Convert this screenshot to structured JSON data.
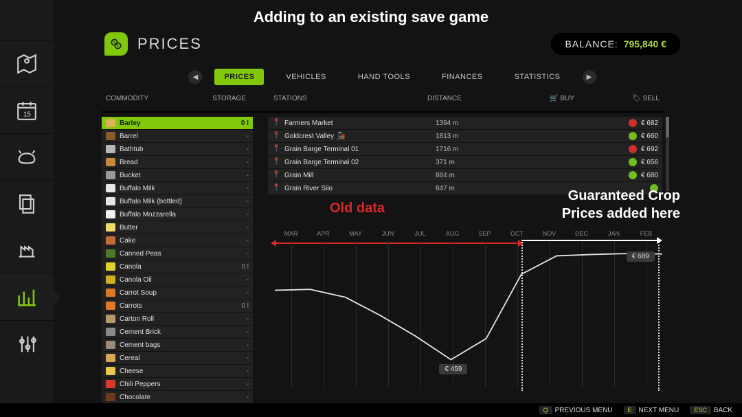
{
  "overlay_title": "Adding to an existing save game",
  "page": {
    "title": "PRICES"
  },
  "balance": {
    "label": "BALANCE:",
    "value": "795,840 €"
  },
  "tabs": [
    "PRICES",
    "VEHICLES",
    "HAND TOOLS",
    "FINANCES",
    "STATISTICS"
  ],
  "active_tab": 0,
  "columns": {
    "commodity": "COMMODITY",
    "storage": "STORAGE",
    "stations": "STATIONS",
    "distance": "DISTANCE",
    "buy": "BUY",
    "sell": "SELL"
  },
  "commodities": [
    {
      "name": "Barley",
      "storage": "0 l",
      "active": true,
      "icon": "#d8b15a"
    },
    {
      "name": "Barrel",
      "storage": "-",
      "icon": "#8b5a2b"
    },
    {
      "name": "Bathtub",
      "storage": "-",
      "icon": "#b8b8b8"
    },
    {
      "name": "Bread",
      "storage": "-",
      "icon": "#c78a3a"
    },
    {
      "name": "Bucket",
      "storage": "-",
      "icon": "#9a9a9a"
    },
    {
      "name": "Buffalo Milk",
      "storage": "-",
      "icon": "#e8e8e8"
    },
    {
      "name": "Buffalo Milk (bottled)",
      "storage": "-",
      "icon": "#e8e8e8"
    },
    {
      "name": "Buffalo Mozzarella",
      "storage": "-",
      "icon": "#f2f2f2"
    },
    {
      "name": "Butter",
      "storage": "-",
      "icon": "#f0d96a"
    },
    {
      "name": "Cake",
      "storage": "-",
      "icon": "#c76a3a"
    },
    {
      "name": "Canned Peas",
      "storage": "-",
      "icon": "#4a7a2a"
    },
    {
      "name": "Canola",
      "storage": "0 l",
      "icon": "#e0d030"
    },
    {
      "name": "Canola Oil",
      "storage": "-",
      "icon": "#d0b020"
    },
    {
      "name": "Carrot Soup",
      "storage": "-",
      "icon": "#d87a2a"
    },
    {
      "name": "Carrots",
      "storage": "0 l",
      "icon": "#e07a2a"
    },
    {
      "name": "Carton Roll",
      "storage": "-",
      "icon": "#b89a6a"
    },
    {
      "name": "Cement Brick",
      "storage": "-",
      "icon": "#8a8a8a"
    },
    {
      "name": "Cement bags",
      "storage": "-",
      "icon": "#9a8a7a"
    },
    {
      "name": "Cereal",
      "storage": "-",
      "icon": "#d8a85a"
    },
    {
      "name": "Cheese",
      "storage": "-",
      "icon": "#e8c84a"
    },
    {
      "name": "Chili Peppers",
      "storage": "-",
      "icon": "#d83a2a"
    },
    {
      "name": "Chocolate",
      "storage": "-",
      "icon": "#6a3a1a"
    }
  ],
  "stations": [
    {
      "name": "Farmers Market",
      "distance": "1394 m",
      "sell": "€ 682",
      "trend": "down",
      "train": false
    },
    {
      "name": "Goldcrest Valley",
      "distance": "1813 m",
      "sell": "€ 660",
      "trend": "up",
      "train": true
    },
    {
      "name": "Grain Barge Terminal 01",
      "distance": "1716 m",
      "sell": "€ 692",
      "trend": "down",
      "train": false
    },
    {
      "name": "Grain Barge Terminal 02",
      "distance": "371 m",
      "sell": "€ 656",
      "trend": "up",
      "train": false
    },
    {
      "name": "Grain Mill",
      "distance": "884 m",
      "sell": "€ 680",
      "trend": "up",
      "train": false
    },
    {
      "name": "Grain River Silo",
      "distance": "847 m",
      "sell": "",
      "trend": "up",
      "train": false
    }
  ],
  "chart_data": {
    "type": "line",
    "months": [
      "MAR",
      "APR",
      "MAY",
      "JUN",
      "JUL",
      "AUG",
      "SEP",
      "OCT",
      "NOV",
      "DEC",
      "JAN",
      "FEB"
    ],
    "values": [
      610,
      612,
      595,
      555,
      510,
      459,
      505,
      645,
      685,
      688,
      690,
      689
    ],
    "low_label": "€ 459",
    "high_label": "€ 689",
    "split_after_index": 7,
    "ylim": [
      400,
      720
    ]
  },
  "annotations": {
    "old": "Old data",
    "new_l1": "Guaranteed Crop",
    "new_l2": "Prices added here"
  },
  "footer": {
    "prev": "PREVIOUS MENU",
    "next": "NEXT MENU",
    "back": "BACK",
    "keys": {
      "q": "Q",
      "e": "E",
      "esc": "ESC"
    }
  },
  "sidebar_icons": [
    "map",
    "calendar",
    "animals",
    "contracts",
    "production",
    "stats",
    "settings"
  ]
}
